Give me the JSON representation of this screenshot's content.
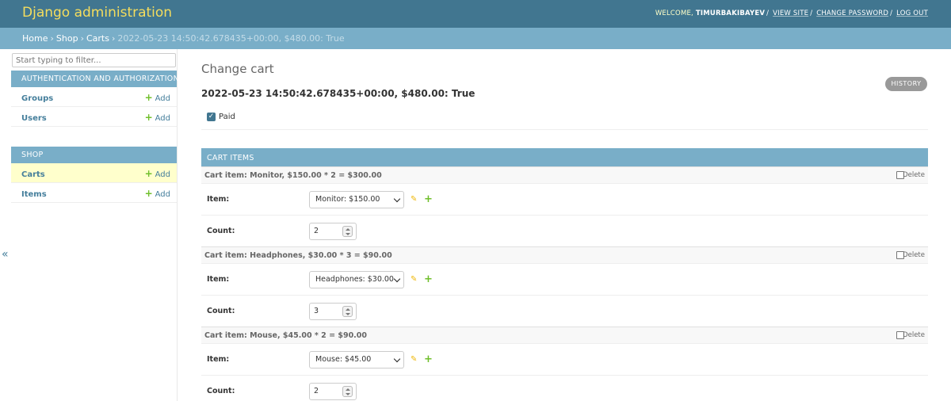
{
  "header": {
    "site_name": "Django administration",
    "welcome": "WELCOME,",
    "username": "TIMURBAKIBAYEV",
    "view_site": "VIEW SITE",
    "change_password": "CHANGE PASSWORD",
    "log_out": "LOG OUT",
    "separator": "/"
  },
  "breadcrumbs": {
    "home": "Home",
    "shop": "Shop",
    "carts": "Carts",
    "current": "2022-05-23 14:50:42.678435+00:00, $480.00: True",
    "sep": "›"
  },
  "sidebar": {
    "filter_placeholder": "Start typing to filter...",
    "auth_caption": "AUTHENTICATION AND AUTHORIZATION",
    "shop_caption": "SHOP",
    "add_label": "Add",
    "items": [
      {
        "label": "Groups"
      },
      {
        "label": "Users"
      },
      {
        "label": "Carts"
      },
      {
        "label": "Items"
      }
    ],
    "toggle": "«"
  },
  "content": {
    "title": "Change cart",
    "object_title": "2022-05-23 14:50:42.678435+00:00, $480.00: True",
    "history": "HISTORY",
    "paid_label": "Paid",
    "paid_checked": true
  },
  "inline": {
    "caption": "CART ITEMS",
    "delete_label": "Delete",
    "item_label": "Item:",
    "count_label": "Count:",
    "rows": [
      {
        "header": "Cart item: Monitor, $150.00 * 2 = $300.00",
        "item": "Monitor: $150.00",
        "count": "2"
      },
      {
        "header": "Cart item: Headphones, $30.00 * 3 = $90.00",
        "item": "Headphones: $30.00",
        "count": "3"
      },
      {
        "header": "Cart item: Mouse, $45.00 * 2 = $90.00",
        "item": "Mouse: $45.00",
        "count": "2"
      }
    ]
  },
  "colors": {
    "header_bg": "#417690",
    "breadcrumb_bg": "#79aec8",
    "site_name": "#f5dd5d",
    "link": "#447e9b",
    "add_green": "#70bf2b",
    "current_row": "#ffffcc"
  },
  "icons": {
    "add": "plus-icon",
    "change": "pencil-icon",
    "checkbox": "checkmark-icon",
    "collapse": "double-chevron-left-icon"
  }
}
